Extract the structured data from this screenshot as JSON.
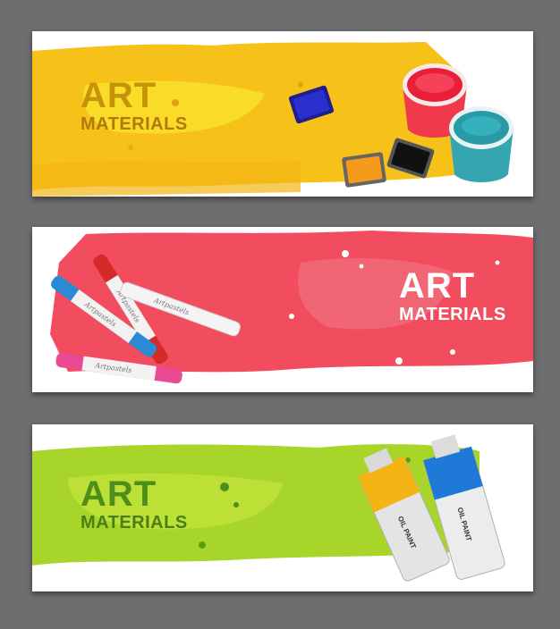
{
  "banners": [
    {
      "title": "ART",
      "subtitle": "MATERIALS",
      "theme": "yellow",
      "accent": "#f5c518",
      "product": "watercolor-paints"
    },
    {
      "title": "ART",
      "subtitle": "MATERIALS",
      "theme": "red",
      "accent": "#f04e5e",
      "product": "pastels"
    },
    {
      "title": "ART",
      "subtitle": "MATERIALS",
      "theme": "green",
      "accent": "#a7d62a",
      "product": "oil-paint-tubes"
    }
  ],
  "pastel_label": "Artpastels",
  "tube_label": "OIL PAINT"
}
